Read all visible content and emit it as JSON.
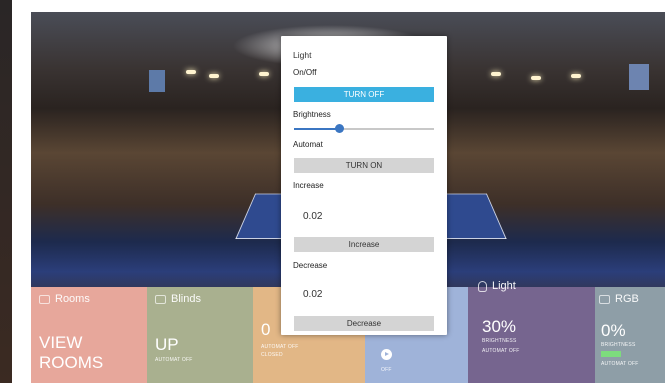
{
  "modal": {
    "title": "Light",
    "onoff_label": "On/Off",
    "onoff_button": "TURN OFF",
    "brightness_label": "Brightness",
    "brightness_level": 0.32,
    "automat_label": "Automat",
    "automat_button": "TURN ON",
    "increase_label": "Increase",
    "increase_value": "0.02",
    "increase_button": "Increase",
    "decrease_label": "Decrease",
    "decrease_value": "0.02",
    "decrease_button": "Decrease"
  },
  "tiles": {
    "rooms": {
      "title": "Rooms",
      "value": "VIEW\nROOMS",
      "color": "#e7a79b",
      "icon": "rooms-icon"
    },
    "blinds": {
      "title": "Blinds",
      "value": "UP",
      "status": "AUTOMAT OFF",
      "color": "#a9b08f",
      "icon": "blinds-icon"
    },
    "climate": {
      "value": "0",
      "status": "AUTOMAT OFF",
      "status2": "CLOSED",
      "color": "#e2b786"
    },
    "media": {
      "status": "OFF",
      "color": "#9fb3d9",
      "icon": "play-icon"
    },
    "light": {
      "title": "Light",
      "value": "30%",
      "status": "BRIGHTNESS",
      "status2": "AUTOMAT OFF",
      "color": "#76658f",
      "icon": "bulb-icon"
    },
    "rgb": {
      "title": "RGB",
      "value": "0%",
      "status": "BRIGHTNESS",
      "status2": "AUTOMAT OFF",
      "color": "#8e9ea7",
      "swatch": "#7ddc7d",
      "icon": "rgb-icon"
    }
  }
}
